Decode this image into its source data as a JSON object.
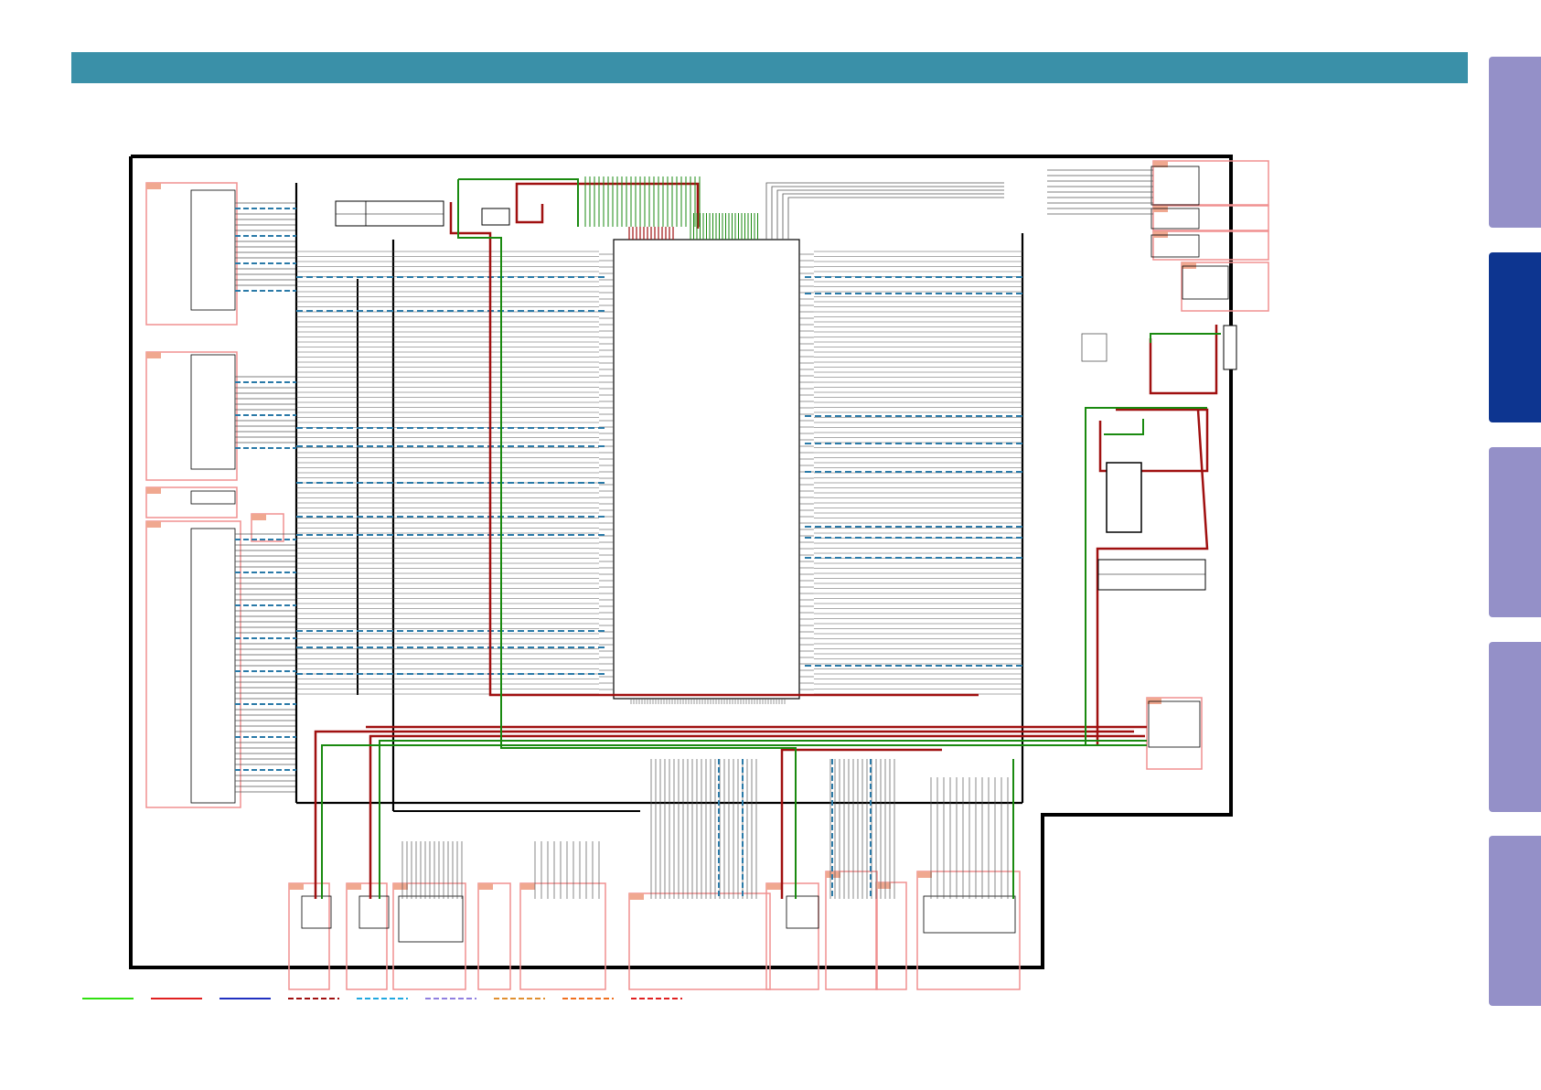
{
  "header": {
    "color": "#3a90a8"
  },
  "side_tabs": [
    {
      "state": "inactive",
      "color": "#9490c8"
    },
    {
      "state": "active",
      "color": "#0d3590"
    },
    {
      "state": "inactive",
      "color": "#9490c8"
    },
    {
      "state": "inactive",
      "color": "#9490c8"
    },
    {
      "state": "inactive",
      "color": "#9490c8"
    }
  ],
  "colors": {
    "board_outline": "#000000",
    "connector_box": "#f09090",
    "connector_tag": "#f0a890",
    "power_red": "#a01010",
    "ground_green": "#1a8a10",
    "bus_dashed": "#2a7aa8",
    "signal": "#555555",
    "link_blue": "#2060d0"
  },
  "legend": [
    {
      "style": "solid",
      "color": "#30e010"
    },
    {
      "style": "solid",
      "color": "#e02020"
    },
    {
      "style": "solid",
      "color": "#2030c0"
    },
    {
      "style": "dashed",
      "color": "#a01010"
    },
    {
      "style": "dashed",
      "color": "#20a8e0"
    },
    {
      "style": "dashed",
      "color": "#9080e0"
    },
    {
      "style": "dashed",
      "color": "#e09030"
    },
    {
      "style": "dashed",
      "color": "#f07020"
    },
    {
      "style": "dashed",
      "color": "#e02020"
    }
  ]
}
